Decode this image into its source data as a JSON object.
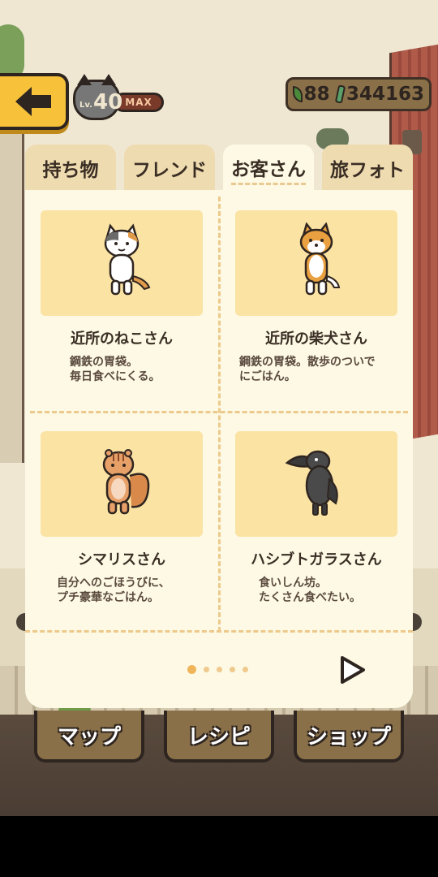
{
  "hud": {
    "level_prefix": "Lv.",
    "level": "40",
    "level_status": "MAX",
    "leaves": "88",
    "money": "344163"
  },
  "tabs": [
    {
      "label": "持ち物",
      "active": false
    },
    {
      "label": "フレンド",
      "active": false
    },
    {
      "label": "お客さん",
      "active": true
    },
    {
      "label": "旅フォト",
      "active": false
    }
  ],
  "customers": [
    {
      "name": "近所のねこさん",
      "desc": "鋼鉄の胃袋。\n毎日食べにくる。",
      "icon": "calico-cat-icon"
    },
    {
      "name": "近所の柴犬さん",
      "desc": "鋼鉄の胃袋。散歩のついで\nにごはん。",
      "icon": "shiba-dog-icon"
    },
    {
      "name": "シマリスさん",
      "desc": "自分へのごほうびに、\nプチ豪華なごはん。",
      "icon": "chipmunk-icon"
    },
    {
      "name": "ハシブトガラスさん",
      "desc": "食いしん坊。\nたくさん食べたい。",
      "icon": "crow-icon"
    }
  ],
  "pager": {
    "total": 5,
    "current": 1
  },
  "bottom_nav": [
    {
      "label": "マップ"
    },
    {
      "label": "レシピ"
    },
    {
      "label": "ショップ"
    }
  ],
  "colors": {
    "accent": "#f7c23a",
    "panel": "#fdf9e5",
    "tab_inactive": "#efdbb0",
    "card": "#fbe3a4",
    "text": "#3a2e24"
  }
}
